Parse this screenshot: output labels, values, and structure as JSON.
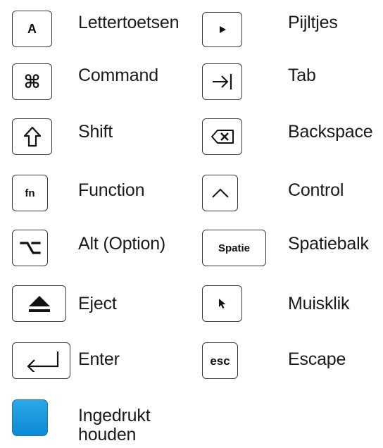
{
  "legend": {
    "left": [
      {
        "key_text": "A",
        "label": "Lettertoetsen"
      },
      {
        "key_text": "⌘",
        "label": "Command"
      },
      {
        "key_icon": "shift-icon",
        "label": "Shift"
      },
      {
        "key_text": "fn",
        "label": "Function"
      },
      {
        "key_icon": "option-icon",
        "label": "Alt (Option)"
      },
      {
        "key_icon": "eject-icon",
        "label": "Eject"
      },
      {
        "key_icon": "return-icon",
        "label": "Enter"
      },
      {
        "key_icon": "held-key",
        "label": "Ingedrukt houden",
        "key_color": "#1a9ae0"
      }
    ],
    "right": [
      {
        "key_icon": "arrow-right-icon",
        "label": "Pijltjes"
      },
      {
        "key_icon": "tab-icon",
        "label": "Tab"
      },
      {
        "key_icon": "backspace-icon",
        "label": "Backspace"
      },
      {
        "key_icon": "caret-up-icon",
        "label": "Control"
      },
      {
        "key_text": "Spatie",
        "label": "Spatiebalk"
      },
      {
        "key_icon": "mouse-pointer-icon",
        "label": "Muisklik"
      },
      {
        "key_text": "esc",
        "label": "Escape"
      }
    ]
  }
}
